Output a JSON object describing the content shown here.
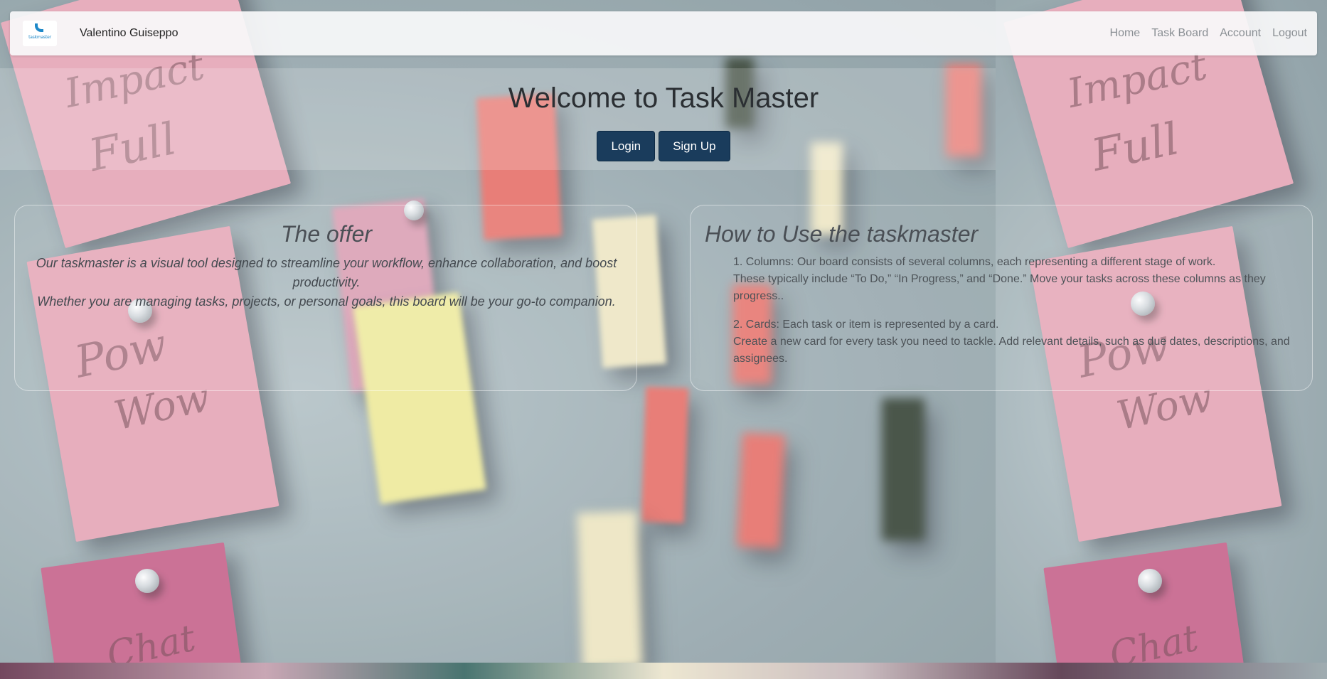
{
  "brand": {
    "logo_text": "taskmaster",
    "user_name": "Valentino Guiseppo"
  },
  "nav": {
    "items": [
      {
        "label": "Home"
      },
      {
        "label": "Task Board"
      },
      {
        "label": "Account"
      },
      {
        "label": "Logout"
      }
    ]
  },
  "hero": {
    "title": "Welcome to Task Master",
    "login_label": "Login",
    "signup_label": "Sign Up"
  },
  "offer": {
    "title": "The offer",
    "lines": [
      "Our taskmaster is a visual tool designed to streamline your workflow, enhance collaboration, and boost productivity.",
      "Whether you are managing tasks, projects, or personal goals, this board will be your go-to companion."
    ]
  },
  "howto": {
    "title": "How to Use the taskmaster",
    "items": [
      {
        "heading": "1. Columns: Our board consists of several columns, each representing a different stage of work.",
        "body": "These typically include “To Do,” “In Progress,” and “Done.” Move your tasks across these columns as they progress.."
      },
      {
        "heading": "2. Cards: Each task or item is represented by a card.",
        "body": "Create a new card for every task you need to tackle. Add relevant details, such as due dates, descriptions, and assignees."
      }
    ]
  },
  "colors": {
    "button_bg": "#1a3c5c",
    "navbar_bg": "#f8f9fa",
    "nav_link": "#8a8f94"
  },
  "background": {
    "note_text": [
      "Impact",
      "Full",
      "Pow",
      "Wow",
      "Chat"
    ]
  }
}
